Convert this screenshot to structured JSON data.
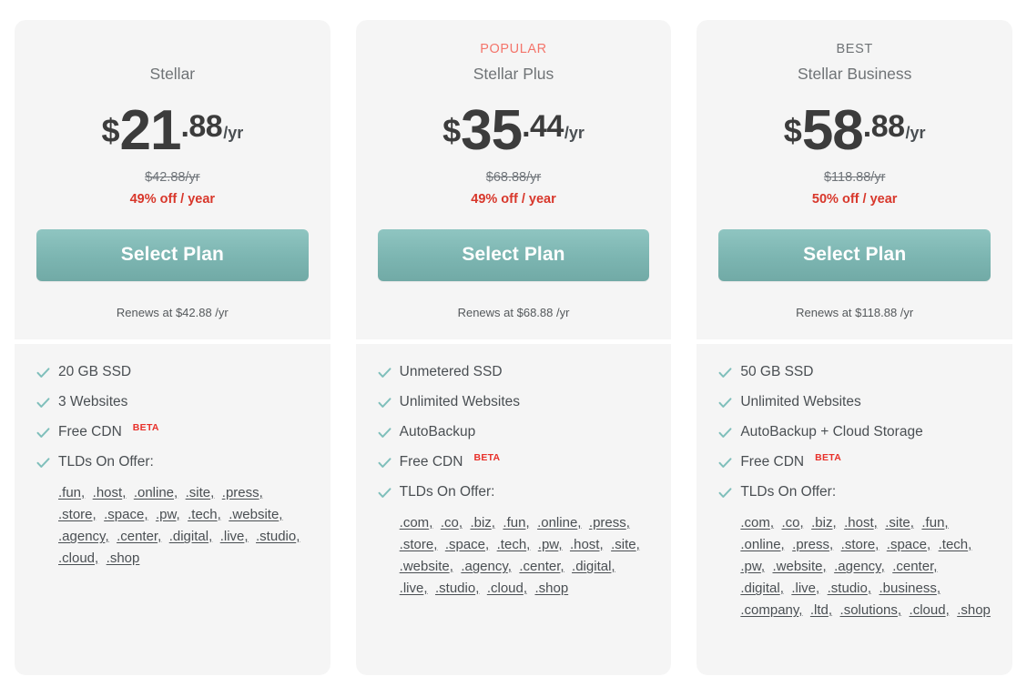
{
  "colors": {
    "card_bg": "#f5f5f5",
    "page_bg": "#ffffff",
    "accent_teal": "#7cb5b1",
    "popular_coral": "#f4756b",
    "discount_red": "#d8372b",
    "beta_red": "#e8302a",
    "check_teal": "#7fbfbb",
    "text_gray": "#4a4f53",
    "muted_gray": "#6f7376"
  },
  "common": {
    "select_plan_label": "Select Plan",
    "tlds_label": "TLDs On Offer:",
    "beta_badge": "BETA",
    "per_suffix": "/yr",
    "check_icon": "check-icon"
  },
  "plans": [
    {
      "ribbon": "",
      "ribbon_kind": "none",
      "name": "Stellar",
      "currency": "$",
      "price_int": "21",
      "price_dec": ".88",
      "per": "/yr",
      "old_price": "$42.88/yr",
      "discount": "49% off / year",
      "cta": "Select Plan",
      "renews": "Renews at $42.88 /yr",
      "features": [
        {
          "text": "20 GB SSD",
          "beta": false
        },
        {
          "text": "3 Websites",
          "beta": false
        },
        {
          "text": "Free CDN",
          "beta": true
        },
        {
          "text": "TLDs On Offer:",
          "beta": false
        }
      ],
      "tlds": [
        ".fun",
        ".host",
        ".online",
        ".site",
        ".press",
        ".store",
        ".space",
        ".pw",
        ".tech",
        ".website",
        ".agency",
        ".center",
        ".digital",
        ".live",
        ".studio",
        ".cloud",
        ".shop"
      ]
    },
    {
      "ribbon": "POPULAR",
      "ribbon_kind": "popular",
      "name": "Stellar Plus",
      "currency": "$",
      "price_int": "35",
      "price_dec": ".44",
      "per": "/yr",
      "old_price": "$68.88/yr",
      "discount": "49% off / year",
      "cta": "Select Plan",
      "renews": "Renews at $68.88 /yr",
      "features": [
        {
          "text": "Unmetered SSD",
          "beta": false
        },
        {
          "text": "Unlimited Websites",
          "beta": false
        },
        {
          "text": "AutoBackup",
          "beta": false
        },
        {
          "text": "Free CDN",
          "beta": true
        },
        {
          "text": "TLDs On Offer:",
          "beta": false
        }
      ],
      "tlds": [
        ".com",
        ".co",
        ".biz",
        ".fun",
        ".online",
        ".press",
        ".store",
        ".space",
        ".tech",
        ".pw",
        ".host",
        ".site",
        ".website",
        ".agency",
        ".center",
        ".digital",
        ".live",
        ".studio",
        ".cloud",
        ".shop"
      ]
    },
    {
      "ribbon": "BEST",
      "ribbon_kind": "best",
      "name": "Stellar Business",
      "currency": "$",
      "price_int": "58",
      "price_dec": ".88",
      "per": "/yr",
      "old_price": "$118.88/yr",
      "discount": "50% off / year",
      "cta": "Select Plan",
      "renews": "Renews at $118.88 /yr",
      "features": [
        {
          "text": "50 GB SSD",
          "beta": false
        },
        {
          "text": "Unlimited Websites",
          "beta": false
        },
        {
          "text": "AutoBackup + Cloud Storage",
          "beta": false
        },
        {
          "text": "Free CDN",
          "beta": true
        },
        {
          "text": "TLDs On Offer:",
          "beta": false
        }
      ],
      "tlds": [
        ".com",
        ".co",
        ".biz",
        ".host",
        ".site",
        ".fun",
        ".online",
        ".press",
        ".store",
        ".space",
        ".tech",
        ".pw",
        ".website",
        ".agency",
        ".center",
        ".digital",
        ".live",
        ".studio",
        ".business",
        ".company",
        ".ltd",
        ".solutions",
        ".cloud",
        ".shop"
      ]
    }
  ]
}
